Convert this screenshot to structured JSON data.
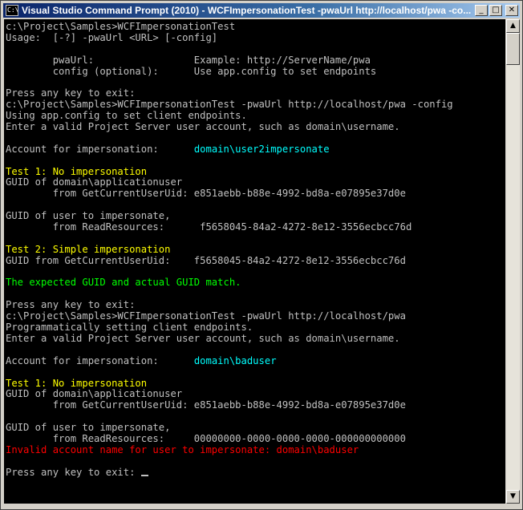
{
  "window": {
    "icon_label": "C:\\",
    "title": "Visual Studio Command Prompt (2010) - WCFImpersonationTest  -pwaUrl http://localhost/pwa -co...",
    "minimize_label": "_",
    "maximize_label": "□",
    "close_label": "✕"
  },
  "console": {
    "line_01": "c:\\Project\\Samples>WCFImpersonationTest",
    "line_02": "Usage:  [-?] -pwaUrl <URL> [-config]",
    "line_03": "",
    "line_04": "        pwaUrl:                 Example: http://ServerName/pwa",
    "line_05": "        config (optional):      Use app.config to set endpoints",
    "line_06": "",
    "line_07": "Press any key to exit:",
    "line_08": "c:\\Project\\Samples>WCFImpersonationTest -pwaUrl http://localhost/pwa -config",
    "line_09": "Using app.config to set client endpoints.",
    "line_10": "Enter a valid Project Server user account, such as domain\\username.",
    "line_11": "",
    "line_12_label": "Account for impersonation:      ",
    "line_12_value": "domain\\user2impersonate",
    "line_13": "",
    "line_14": "Test 1: No impersonation",
    "line_15": "GUID of domain\\applicationuser",
    "line_16": "        from GetCurrentUserUid: e851aebb-b88e-4992-bd8a-e07895e37d0e",
    "line_17": "",
    "line_18": "GUID of user to impersonate,",
    "line_19": "        from ReadResources:      f5658045-84a2-4272-8e12-3556ecbcc76d",
    "line_20": "",
    "line_21": "Test 2: Simple impersonation",
    "line_22": "GUID from GetCurrentUserUid:    f5658045-84a2-4272-8e12-3556ecbcc76d",
    "line_23": "",
    "line_24": "The expected GUID and actual GUID match.",
    "line_25": "",
    "line_26": "Press any key to exit:",
    "line_27": "c:\\Project\\Samples>WCFImpersonationTest -pwaUrl http://localhost/pwa",
    "line_28": "Programmatically setting client endpoints.",
    "line_29": "Enter a valid Project Server user account, such as domain\\username.",
    "line_30": "",
    "line_31_label": "Account for impersonation:      ",
    "line_31_value": "domain\\baduser",
    "line_32": "",
    "line_33": "Test 1: No impersonation",
    "line_34": "GUID of domain\\applicationuser",
    "line_35": "        from GetCurrentUserUid: e851aebb-b88e-4992-bd8a-e07895e37d0e",
    "line_36": "",
    "line_37": "GUID of user to impersonate,",
    "line_38": "        from ReadResources:     00000000-0000-0000-0000-000000000000",
    "line_39": "Invalid account name for user to impersonate: domain\\baduser",
    "line_40": "",
    "line_41": "Press any key to exit: "
  },
  "colors": {
    "default_text": "#c0c0c0",
    "highlight_cyan": "#00ffff",
    "test_heading_yellow": "#ffff00",
    "success_green": "#00ff00",
    "error_red": "#ff0000",
    "background": "#000000"
  },
  "scrollbar": {
    "up_arrow": "▲",
    "down_arrow": "▼"
  }
}
